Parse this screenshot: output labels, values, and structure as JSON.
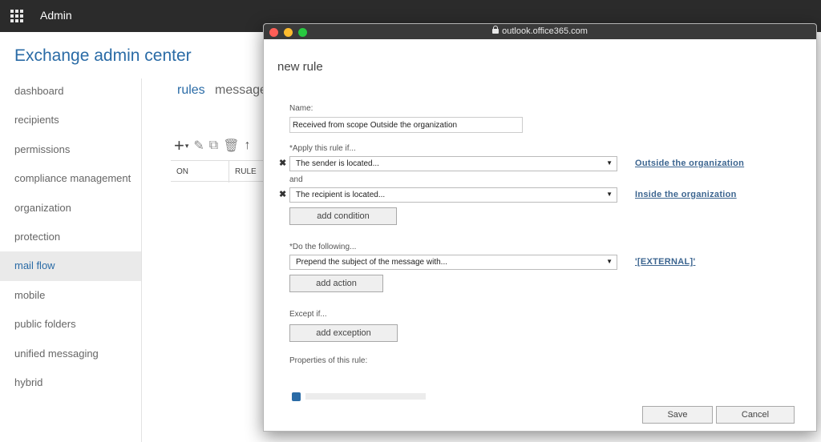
{
  "topbar": {
    "title": "Admin"
  },
  "eac": {
    "title": "Exchange admin center",
    "nav": [
      {
        "label": "dashboard"
      },
      {
        "label": "recipients"
      },
      {
        "label": "permissions"
      },
      {
        "label": "compliance management"
      },
      {
        "label": "organization"
      },
      {
        "label": "protection"
      },
      {
        "label": "mail flow",
        "active": true
      },
      {
        "label": "mobile"
      },
      {
        "label": "public folders"
      },
      {
        "label": "unified messaging"
      },
      {
        "label": "hybrid"
      }
    ],
    "tabs": {
      "rules": "rules",
      "message": "message"
    },
    "grid_headers": {
      "on": "ON",
      "rule": "RULE"
    }
  },
  "browser": {
    "url": "outlook.office365.com"
  },
  "dialog": {
    "title": "new rule",
    "name_label": "Name:",
    "name_value": "Received from scope Outside the organization",
    "apply_label": "*Apply this rule if...",
    "condition1": {
      "value": "The sender is located...",
      "link": "Outside the organization"
    },
    "and_label": "and",
    "condition2": {
      "value": "The recipient is located...",
      "link": "Inside the organization"
    },
    "add_condition": "add condition",
    "do_label": "*Do the following...",
    "action1": {
      "value": "Prepend the subject of the message with...",
      "link": "'[EXTERNAL]'"
    },
    "add_action": "add action",
    "except_label": "Except if...",
    "add_exception": "add exception",
    "properties_label": "Properties of this rule:",
    "save": "Save",
    "cancel": "Cancel"
  },
  "colors": {
    "accent": "#2a6ba6",
    "link": "#3c6590",
    "topbar": "#2b2b2b"
  }
}
